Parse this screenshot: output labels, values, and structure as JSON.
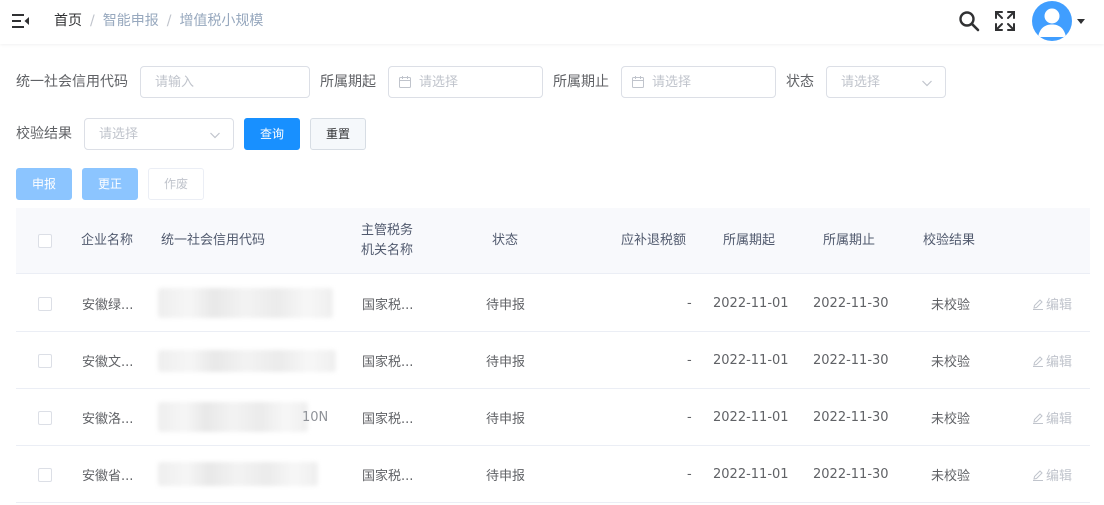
{
  "breadcrumb": [
    "首页",
    "智能申报",
    "增值税小规模"
  ],
  "filters": {
    "credit_code_label": "统一社会信用代码",
    "credit_code_placeholder": "请输入",
    "period_start_label": "所属期起",
    "period_start_placeholder": "请选择",
    "period_end_label": "所属期止",
    "period_end_placeholder": "请选择",
    "status_label": "状态",
    "status_placeholder": "请选择",
    "check_result_label": "校验结果",
    "check_result_placeholder": "请选择",
    "query_label": "查询",
    "reset_label": "重置"
  },
  "actions": {
    "declare_label": "申报",
    "correct_label": "更正",
    "void_label": "作废"
  },
  "table": {
    "columns": {
      "company": "企业名称",
      "credit_code": "统一社会信用代码",
      "tax_authority_line1": "主管税务",
      "tax_authority_line2": "机关名称",
      "status": "状态",
      "refund": "应补退税额",
      "period_start": "所属期起",
      "period_end": "所属期止",
      "check_result": "校验结果"
    },
    "rows": [
      {
        "company": "安徽绿...",
        "credit_code_suffix": "",
        "authority": "国家税...",
        "status": "待申报",
        "refund": "-",
        "period_start": "2022-11-01",
        "period_end": "2022-11-30",
        "check_result": "未校验",
        "edit": "编辑"
      },
      {
        "company": "安徽文...",
        "credit_code_suffix": "",
        "authority": "国家税...",
        "status": "待申报",
        "refund": "-",
        "period_start": "2022-11-01",
        "period_end": "2022-11-30",
        "check_result": "未校验",
        "edit": "编辑"
      },
      {
        "company": "安徽洛...",
        "credit_code_suffix": "10N",
        "authority": "国家税...",
        "status": "待申报",
        "refund": "-",
        "period_start": "2022-11-01",
        "period_end": "2022-11-30",
        "check_result": "未校验",
        "edit": "编辑"
      },
      {
        "company": "安徽省...",
        "credit_code_suffix": "",
        "authority": "国家税...",
        "status": "待申报",
        "refund": "-",
        "period_start": "2022-11-01",
        "period_end": "2022-11-30",
        "check_result": "未校验",
        "edit": "编辑"
      }
    ]
  },
  "colors": {
    "primary": "#1890ff",
    "avatar_bg": "#409eff",
    "header_row_bg": "#f8f9fc",
    "muted_text": "#97a8be"
  }
}
